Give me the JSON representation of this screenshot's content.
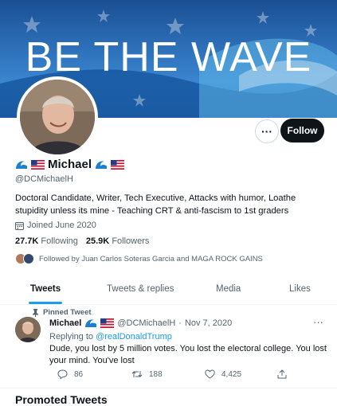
{
  "banner": {
    "text": "BE THE WAVE"
  },
  "profile": {
    "name": "Michael",
    "handle": "@DCMichaelH",
    "bio": "Doctoral Candidate, Writer, Tech Executive, Attacks with humor, Loathe stupidity unless its mine - Teaching CRT & anti-fascism to 1st graders",
    "joined": "Joined June 2020",
    "following_count": "27.7K",
    "following_label": "Following",
    "followers_count": "25.9K",
    "followers_label": "Followers",
    "followed_by": "Followed by Juan Carlos Soteras Garcia and MAGA ROCK GAINS"
  },
  "actions": {
    "more_label": "···",
    "follow_label": "Follow"
  },
  "tabs": [
    {
      "label": "Tweets",
      "active": true
    },
    {
      "label": "Tweets & replies",
      "active": false
    },
    {
      "label": "Media",
      "active": false
    },
    {
      "label": "Likes",
      "active": false
    }
  ],
  "pinned_tweet": {
    "pinned_label": "Pinned Tweet",
    "author_name": "Michael",
    "author_handle": "@DCMichaelH",
    "separator": "·",
    "date": "Nov 7, 2020",
    "replying_prefix": "Replying to",
    "replying_to": "@realDonaldTrump",
    "text": "Dude, you lost by 5 million votes.  You lost the electoral college.  You lost your mind.  You've lost",
    "replies": "86",
    "retweets": "188",
    "likes": "4,425",
    "more_label": "···"
  },
  "next_section": {
    "title": "Promoted Tweets"
  },
  "colors": {
    "accent": "#1d9bf0",
    "text": "#0f1419",
    "muted": "#536471",
    "button_dark": "#0f1419"
  },
  "icons": [
    "wave-emoji-icon",
    "us-flag-icon",
    "calendar-icon",
    "pin-icon",
    "reply-icon",
    "retweet-icon",
    "like-icon",
    "share-icon"
  ]
}
